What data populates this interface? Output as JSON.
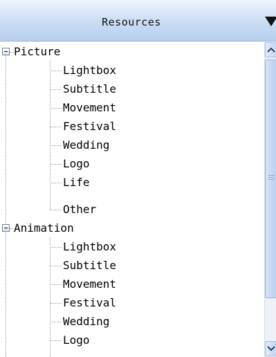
{
  "header": {
    "title": "Resources",
    "dropdown_icon": "triangle-down-icon"
  },
  "tree": {
    "groups": [
      {
        "label": "Picture",
        "expanded": true,
        "children": [
          "Lightbox",
          "Subtitle",
          "Movement",
          "Festival",
          "Wedding",
          "Logo",
          "Life",
          "Other"
        ]
      },
      {
        "label": "Animation",
        "expanded": true,
        "children": [
          "Lightbox",
          "Subtitle",
          "Movement",
          "Festival",
          "Wedding",
          "Logo"
        ]
      }
    ]
  },
  "scrollbar": {
    "up_icon": "chevron-up-icon",
    "down_icon": "chevron-down-icon",
    "grip_icon": "grip-icon"
  },
  "colors": {
    "header_top": "#eef5fd",
    "header_bottom": "#b7cfee",
    "scroll_thumb": "#c4d6ef",
    "text": "#000000"
  }
}
